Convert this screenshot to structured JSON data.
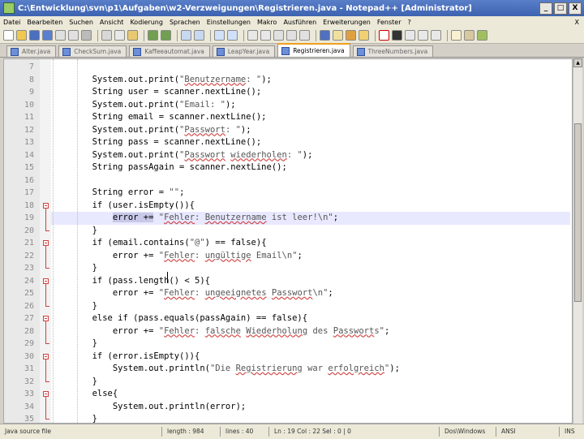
{
  "window": {
    "title": "C:\\Entwicklung\\svn\\p1\\Aufgaben\\w2-Verzweigungen\\Registrieren.java - Notepad++ [Administrator]",
    "buttons": {
      "minimize": "_",
      "maximize": "□",
      "close": "X"
    }
  },
  "menu": {
    "items": [
      "Datei",
      "Bearbeiten",
      "Suchen",
      "Ansicht",
      "Kodierung",
      "Sprachen",
      "Einstellungen",
      "Makro",
      "Ausführen",
      "Erweiterungen",
      "Fenster",
      "?"
    ],
    "close_doc": "X"
  },
  "toolbar": {
    "icons": [
      "new-icon",
      "open-icon",
      "save-icon",
      "save-all-icon",
      "close-icon",
      "close-all-icon",
      "print-icon",
      "cut-icon",
      "copy-icon",
      "paste-icon",
      "undo-icon",
      "redo-icon",
      "find-icon",
      "replace-icon",
      "zoom-in-icon",
      "zoom-out-icon",
      "sync-v-icon",
      "sync-h-icon",
      "wrap-icon",
      "all-chars-icon",
      "indent-guide-icon",
      "udl-icon",
      "doc-map-icon",
      "function-list-icon",
      "record-icon",
      "stop-icon",
      "play-icon",
      "play-multiple-icon",
      "save-macro-icon",
      "spellcheck-icon",
      "tools-icon",
      "plugin-icon"
    ]
  },
  "tabs": [
    {
      "label": "Alter.java",
      "active": false
    },
    {
      "label": "CheckSum.java",
      "active": false
    },
    {
      "label": "Kaffeeautomat.java",
      "active": false
    },
    {
      "label": "LeapYear.java",
      "active": false
    },
    {
      "label": "Registrieren.java",
      "active": true
    },
    {
      "label": "ThreeNumbers.java",
      "active": false
    }
  ],
  "editor": {
    "lines": [
      {
        "n": "7",
        "code": ""
      },
      {
        "n": "8",
        "code": "        System.out.print(\"Benutzername: \");"
      },
      {
        "n": "9",
        "code": "        String user = scanner.nextLine();"
      },
      {
        "n": "10",
        "code": "        System.out.print(\"Email: \");"
      },
      {
        "n": "11",
        "code": "        String email = scanner.nextLine();"
      },
      {
        "n": "12",
        "code": "        System.out.print(\"Passwort: \");"
      },
      {
        "n": "13",
        "code": "        String pass = scanner.nextLine();"
      },
      {
        "n": "14",
        "code": "        System.out.print(\"Passwort wiederholen: \");"
      },
      {
        "n": "15",
        "code": "        String passAgain = scanner.nextLine();"
      },
      {
        "n": "16",
        "code": ""
      },
      {
        "n": "17",
        "code": "        String error = \"\";"
      },
      {
        "n": "18",
        "code": "        if (user.isEmpty()){"
      },
      {
        "n": "19",
        "code": "            error += \"Fehler: Benutzername ist leer!\\n\";"
      },
      {
        "n": "20",
        "code": "        }"
      },
      {
        "n": "21",
        "code": "        if (email.contains(\"@\") == false){"
      },
      {
        "n": "22",
        "code": "            error += \"Fehler: ungültige Email\\n\";"
      },
      {
        "n": "23",
        "code": "        }"
      },
      {
        "n": "24",
        "code": "        if (pass.length() < 5){"
      },
      {
        "n": "25",
        "code": "            error += \"Fehler: ungeeignetes Passwort\\n\";"
      },
      {
        "n": "26",
        "code": "        }"
      },
      {
        "n": "27",
        "code": "        else if (pass.equals(passAgain) == false){"
      },
      {
        "n": "28",
        "code": "            error += \"Fehler: falsche Wiederholung des Passworts\";"
      },
      {
        "n": "29",
        "code": "        }"
      },
      {
        "n": "30",
        "code": "        if (error.isEmpty()){"
      },
      {
        "n": "31",
        "code": "            System.out.println(\"Die Registrierung war erfolgreich\");"
      },
      {
        "n": "32",
        "code": "        }"
      },
      {
        "n": "33",
        "code": "        else{"
      },
      {
        "n": "34",
        "code": "            System.out.println(error);"
      },
      {
        "n": "35",
        "code": "        }"
      }
    ],
    "current_line": "19",
    "colors": {
      "fold_marker": "#d04040",
      "current_line_bg": "#e8e8ff"
    }
  },
  "status": {
    "type": "Java source file",
    "length": "length : 984",
    "lines": "lines : 40",
    "position": "Ln : 19    Col : 22    Sel : 0 | 0",
    "eol": "Dos\\Windows",
    "encoding": "ANSI",
    "mode": "INS"
  }
}
